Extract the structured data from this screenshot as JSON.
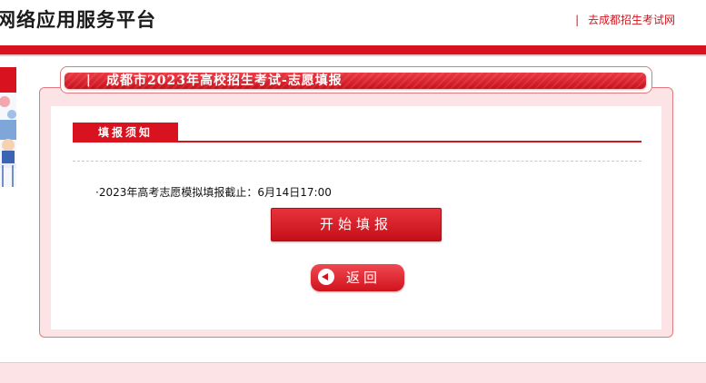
{
  "header": {
    "site_title": "网络应用服务平台",
    "link_bar": "|",
    "link_text": "去成都招生考试网"
  },
  "ribbon": {
    "bar": "|",
    "title": "成都市2023年高校招生考试-志愿填报"
  },
  "section": {
    "title": "填报须知"
  },
  "notice": {
    "text": "·2023年高考志愿模拟填报截止：6月14日17:00"
  },
  "buttons": {
    "start_label": "开始填报",
    "back_label": "返回"
  },
  "colors": {
    "brand_red": "#d8131f",
    "card_pink": "#fbe3e6"
  },
  "icons": {
    "back": "back-arrow-icon"
  }
}
